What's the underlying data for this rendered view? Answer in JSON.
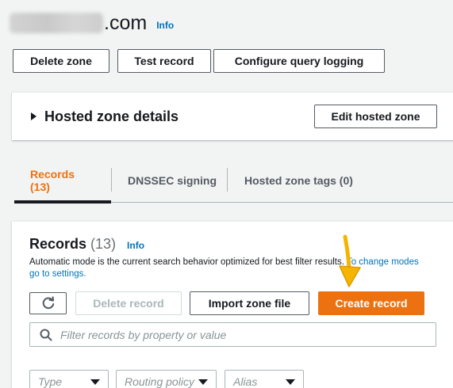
{
  "header": {
    "domain_suffix": ".com",
    "info_label": "Info"
  },
  "actions": {
    "delete_zone": "Delete zone",
    "test_record": "Test record",
    "configure_query_logging": "Configure query logging"
  },
  "details": {
    "title": "Hosted zone details",
    "edit_label": "Edit hosted zone"
  },
  "tabs": [
    {
      "label": "Records (13)",
      "active": true
    },
    {
      "label": "DNSSEC signing",
      "active": false
    },
    {
      "label": "Hosted zone tags (0)",
      "active": false
    }
  ],
  "records": {
    "title": "Records",
    "count": "(13)",
    "info_label": "Info",
    "description": "Automatic mode is the current search behavior optimized for best filter results.",
    "description_link": "To change modes go to settings.",
    "delete_record": "Delete record",
    "import_zone_file": "Import zone file",
    "create_record": "Create record",
    "search_placeholder": "Filter records by property or value",
    "filters": [
      {
        "label": "Type"
      },
      {
        "label": "Routing policy"
      },
      {
        "label": "Alias"
      }
    ]
  },
  "colors": {
    "accent": "#ec7211",
    "link": "#0073bb",
    "annotation_arrow": "#f5b400"
  },
  "icons": {
    "refresh": "refresh-icon",
    "search": "search-icon",
    "details_toggle": "caret-right-icon",
    "annotation": "arrow-down-annotation"
  }
}
